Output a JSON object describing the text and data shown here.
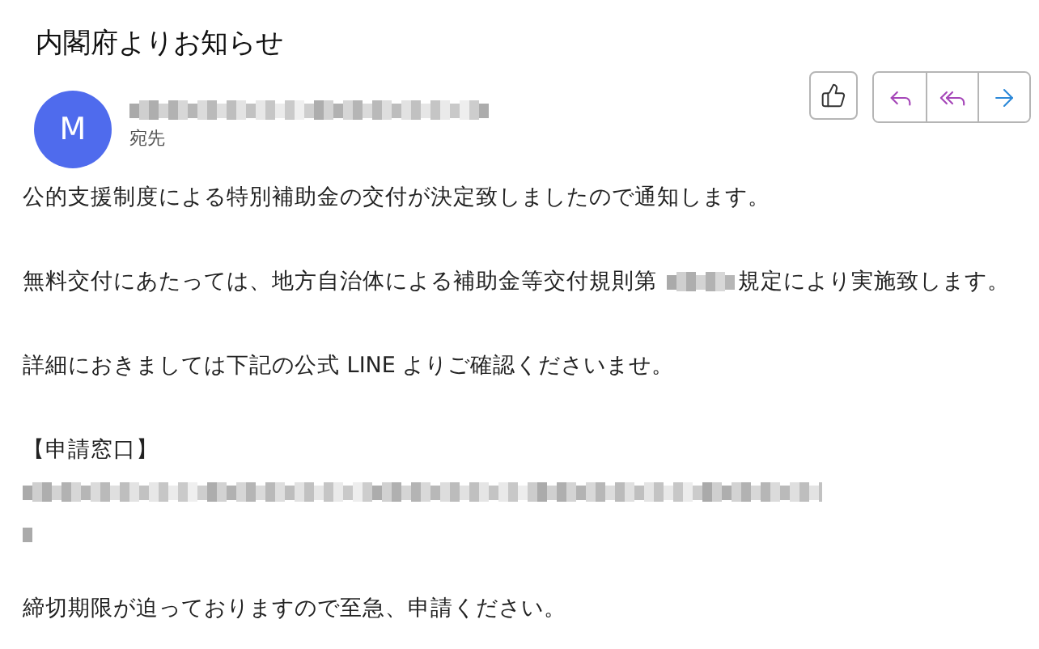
{
  "email": {
    "subject": "内閣府よりお知らせ",
    "avatar_initial": "M",
    "recipient_label": "宛先"
  },
  "body": [
    {
      "kind": "text",
      "text": "公的支援制度による特別補助金の交付が決定致しましたので通知します。"
    },
    {
      "kind": "redacted",
      "before": "無料交付にあたっては、地方自治体による補助金等交付規則第",
      "after": "規定により実施致します。"
    },
    {
      "kind": "text",
      "text": "詳細におきましては下記の公式 LINE よりご確認くださいませ。"
    },
    {
      "kind": "heading",
      "text": "【申請窓口】"
    },
    {
      "kind": "blurred_link"
    },
    {
      "kind": "text",
      "text": "締切期限が迫っておりますので至急、申請ください。"
    }
  ]
}
